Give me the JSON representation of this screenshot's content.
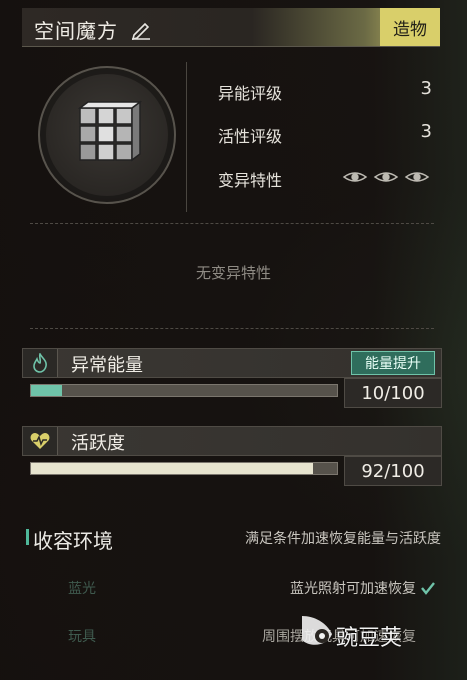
{
  "header": {
    "title": "空间魔方",
    "category": "造物"
  },
  "attributes": [
    {
      "label": "异能评级",
      "value": "3"
    },
    {
      "label": "活性评级",
      "value": "3"
    },
    {
      "label": "变异特性",
      "value": ""
    }
  ],
  "mutation_empty_text": "无变异特性",
  "energy": {
    "title": "异常能量",
    "button_label": "能量提升",
    "value_text": "10/100",
    "fraction": 0.1,
    "fill_color": "#6fc3a9"
  },
  "activity": {
    "title": "活跃度",
    "value_text": "92/100",
    "fraction": 0.92,
    "fill_color": "#e7e4cf"
  },
  "containment": {
    "title": "收容环境",
    "hint": "满足条件加速恢复能量与活跃度",
    "rows": [
      {
        "label": "蓝光",
        "desc": "蓝光照射可加速恢复",
        "satisfied": true
      },
      {
        "label": "玩具",
        "desc": "周围摆放玩具可加速恢复",
        "satisfied": false
      }
    ]
  },
  "watermark": {
    "text": "豌豆荚"
  },
  "colors": {
    "accent": "#6fc3a9",
    "category_tag": "#d9cf6a"
  }
}
